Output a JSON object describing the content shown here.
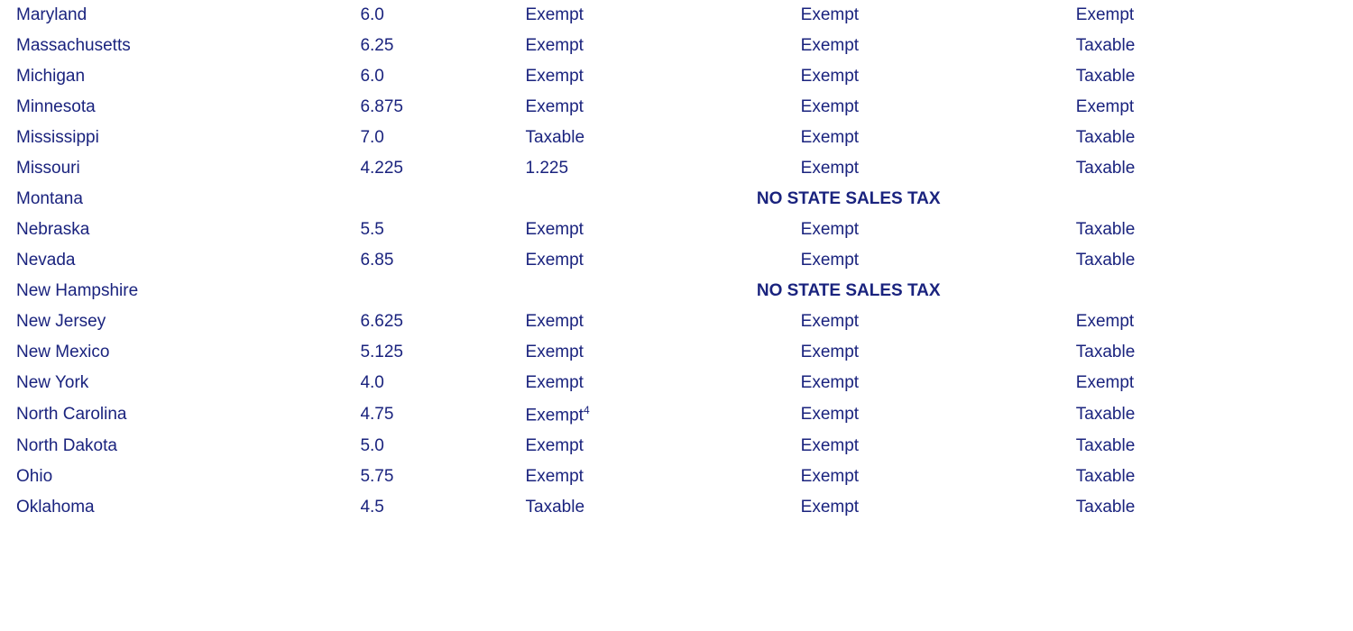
{
  "table": {
    "rows": [
      {
        "state": "Maryland",
        "rate": "6.0",
        "food": "Exempt",
        "prescription": "Exempt",
        "clothing": "Exempt",
        "noTax": false
      },
      {
        "state": "Massachusetts",
        "rate": "6.25",
        "food": "Exempt",
        "prescription": "Exempt",
        "clothing": "Taxable",
        "noTax": false
      },
      {
        "state": "Michigan",
        "rate": "6.0",
        "food": "Exempt",
        "prescription": "Exempt",
        "clothing": "Taxable",
        "noTax": false
      },
      {
        "state": "Minnesota",
        "rate": "6.875",
        "food": "Exempt",
        "prescription": "Exempt",
        "clothing": "Exempt",
        "noTax": false
      },
      {
        "state": "Mississippi",
        "rate": "7.0",
        "food": "Taxable",
        "prescription": "Exempt",
        "clothing": "Taxable",
        "noTax": false
      },
      {
        "state": "Missouri",
        "rate": "4.225",
        "food": "1.225",
        "prescription": "Exempt",
        "clothing": "Taxable",
        "noTax": false
      },
      {
        "state": "Montana",
        "rate": "",
        "food": "",
        "prescription": "",
        "clothing": "",
        "noTax": true,
        "noTaxText": "NO STATE SALES TAX"
      },
      {
        "state": "Nebraska",
        "rate": "5.5",
        "food": "Exempt",
        "prescription": "Exempt",
        "clothing": "Taxable",
        "noTax": false
      },
      {
        "state": "Nevada",
        "rate": "6.85",
        "food": "Exempt",
        "prescription": "Exempt",
        "clothing": "Taxable",
        "noTax": false
      },
      {
        "state": "New Hampshire",
        "rate": "",
        "food": "",
        "prescription": "",
        "clothing": "",
        "noTax": true,
        "noTaxText": "NO STATE SALES TAX"
      },
      {
        "state": "New Jersey",
        "rate": "6.625",
        "food": "Exempt",
        "prescription": "Exempt",
        "clothing": "Exempt",
        "noTax": false
      },
      {
        "state": "New Mexico",
        "rate": "5.125",
        "food": "Exempt",
        "prescription": "Exempt",
        "clothing": "Taxable",
        "noTax": false
      },
      {
        "state": "New York",
        "rate": "4.0",
        "food": "Exempt",
        "prescription": "Exempt",
        "clothing": "Exempt",
        "noTax": false
      },
      {
        "state": "North Carolina",
        "rate": "4.75",
        "food": "Exempt",
        "prescription": "Exempt",
        "clothing": "Taxable",
        "noTax": false,
        "foodSup": "4"
      },
      {
        "state": "North Dakota",
        "rate": "5.0",
        "food": "Exempt",
        "prescription": "Exempt",
        "clothing": "Taxable",
        "noTax": false
      },
      {
        "state": "Ohio",
        "rate": "5.75",
        "food": "Exempt",
        "prescription": "Exempt",
        "clothing": "Taxable",
        "noTax": false
      },
      {
        "state": "Oklahoma",
        "rate": "4.5",
        "food": "Taxable",
        "prescription": "Exempt",
        "clothing": "Taxable",
        "noTax": false
      }
    ]
  }
}
